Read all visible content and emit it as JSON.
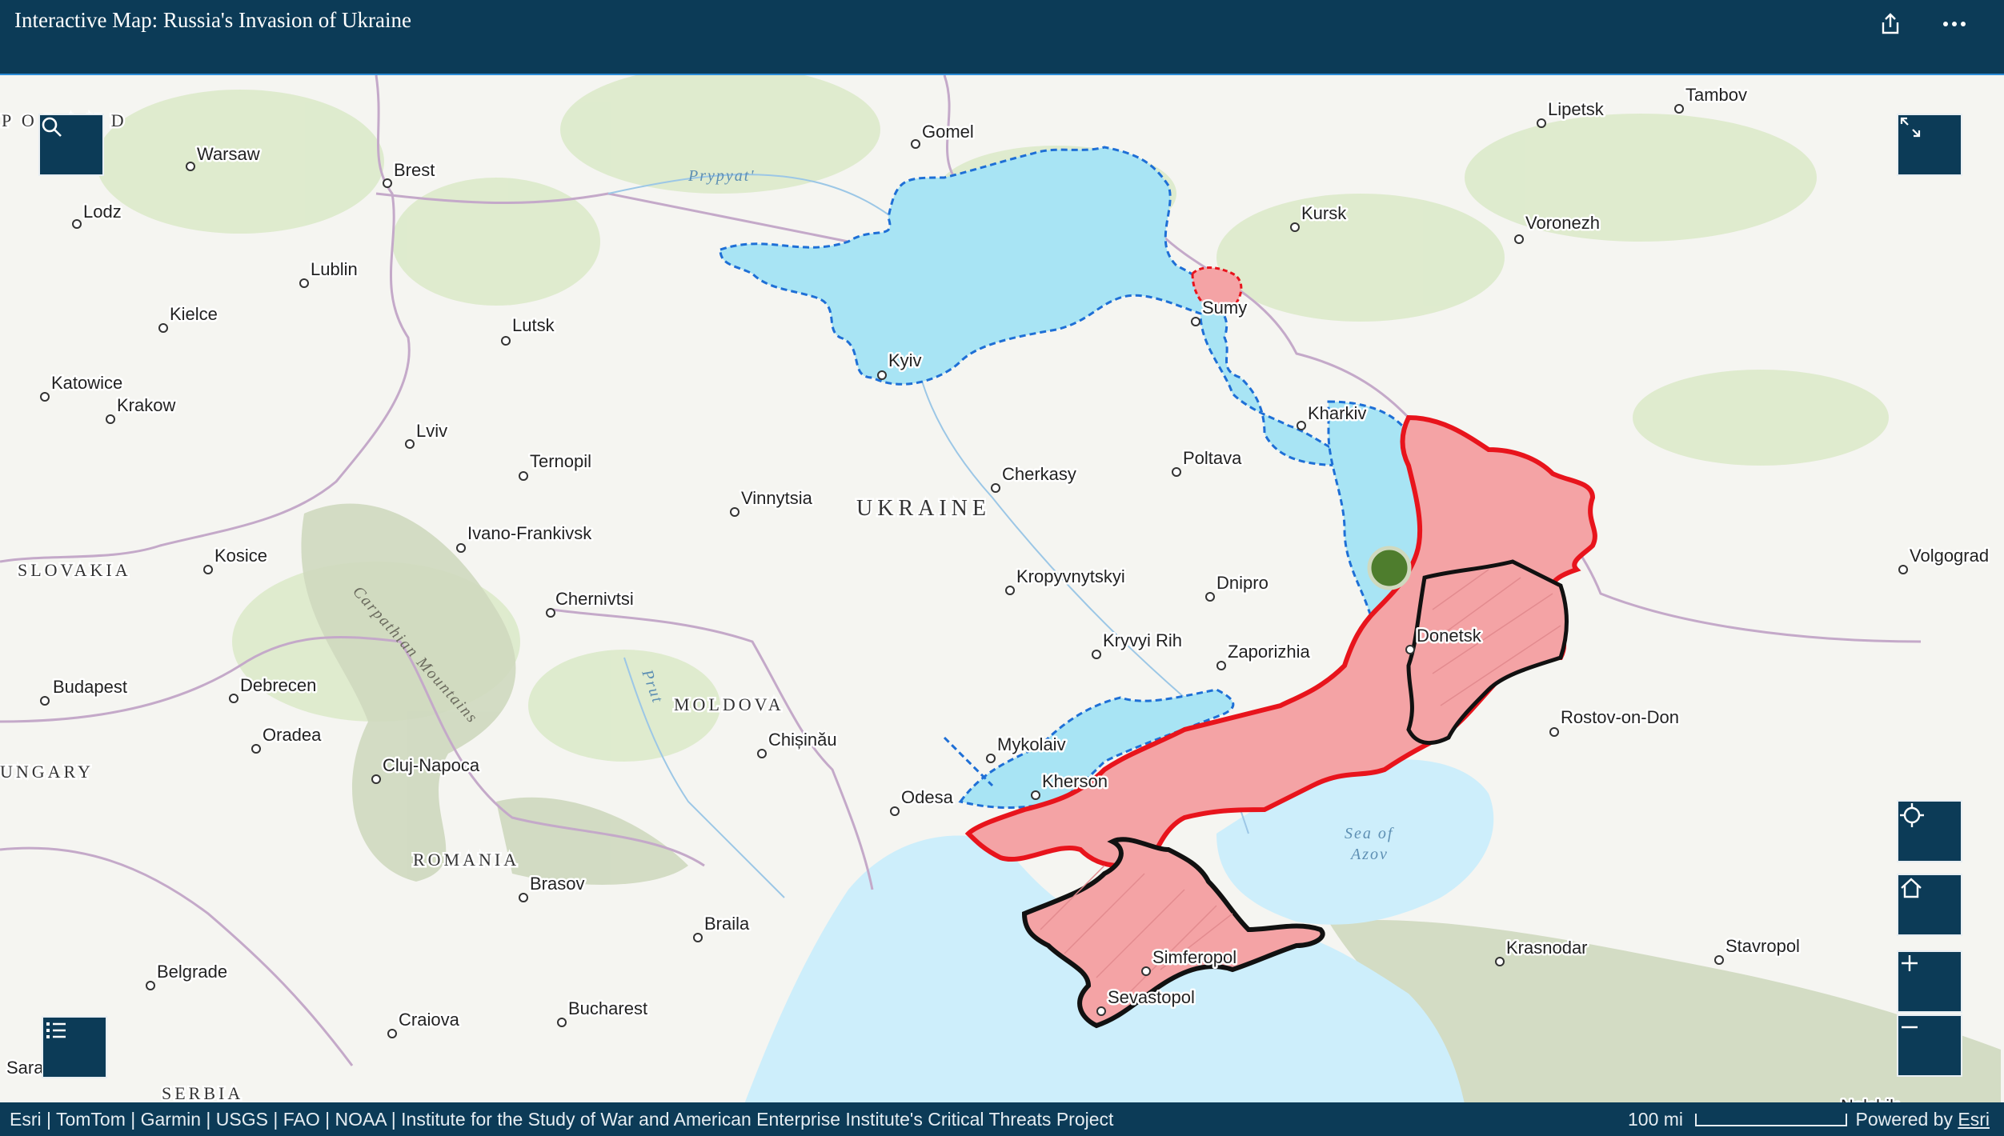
{
  "header": {
    "title": "Interactive Map: Russia's Invasion of Ukraine"
  },
  "icons": {
    "share": "share-icon",
    "more": "more-icon",
    "search": "search-icon",
    "expand": "expand-icon",
    "locate": "locate-icon",
    "home": "home-icon",
    "zoom_in": "zoom-in-icon",
    "zoom_out": "zoom-out-icon",
    "legend": "legend-icon"
  },
  "map": {
    "countries": [
      "UKRAINE",
      "SLOVAKIA",
      "MOLDOVA",
      "ROMANIA",
      "SERBIA",
      "UNGARY",
      "P O L A N D"
    ],
    "water_labels": [
      "Prypyat'",
      "Sea of",
      "Azov",
      "Prut"
    ],
    "mountain_label": "Carpathian Mountains",
    "cities": [
      "Warsaw",
      "Lodz",
      "Brest",
      "Gomel",
      "Lipetsk",
      "Tambov",
      "Kursk",
      "Voronezh",
      "Lublin",
      "Kielce",
      "Sumy",
      "Lutsk",
      "Kyiv",
      "Katowice",
      "Krakow",
      "Kharkiv",
      "Lviv",
      "Ternopil",
      "Poltava",
      "Cherkasy",
      "Vinnytsia",
      "Ivano-Frankivsk",
      "Kosice",
      "Volgograd",
      "Kropyvnytskyi",
      "Dnipro",
      "Chernivtsi",
      "Donetsk",
      "Kryvyi Rih",
      "Zaporizhia",
      "Budapest",
      "Debrecen",
      "Rostov-on-Don",
      "Chișinău",
      "Oradea",
      "Mykolaiv",
      "Cluj-Napoca",
      "Kherson",
      "Odesa",
      "Brasov",
      "Braila",
      "Simferopol",
      "Krasnodar",
      "Stavropol",
      "Belgrade",
      "Sevastopol",
      "Bucharest",
      "Craiova",
      "Sara",
      "Nalchik"
    ],
    "colors": {
      "occupied": "#f4a3a5",
      "occupied_border": "#e8141c",
      "liberated": "#a8e4f4",
      "liberated_border": "#1e6fd6",
      "annexed_border": "#111111",
      "sea": "#cdeefb",
      "marker": "#4e7d2d"
    }
  },
  "attribution": {
    "text": "Esri | TomTom | Garmin | USGS | FAO | NOAA | Institute for the Study of War and American Enterprise Institute's Critical Threats Project",
    "scale": "100 mi",
    "powered": "Powered by",
    "powered_link": "Esri"
  }
}
